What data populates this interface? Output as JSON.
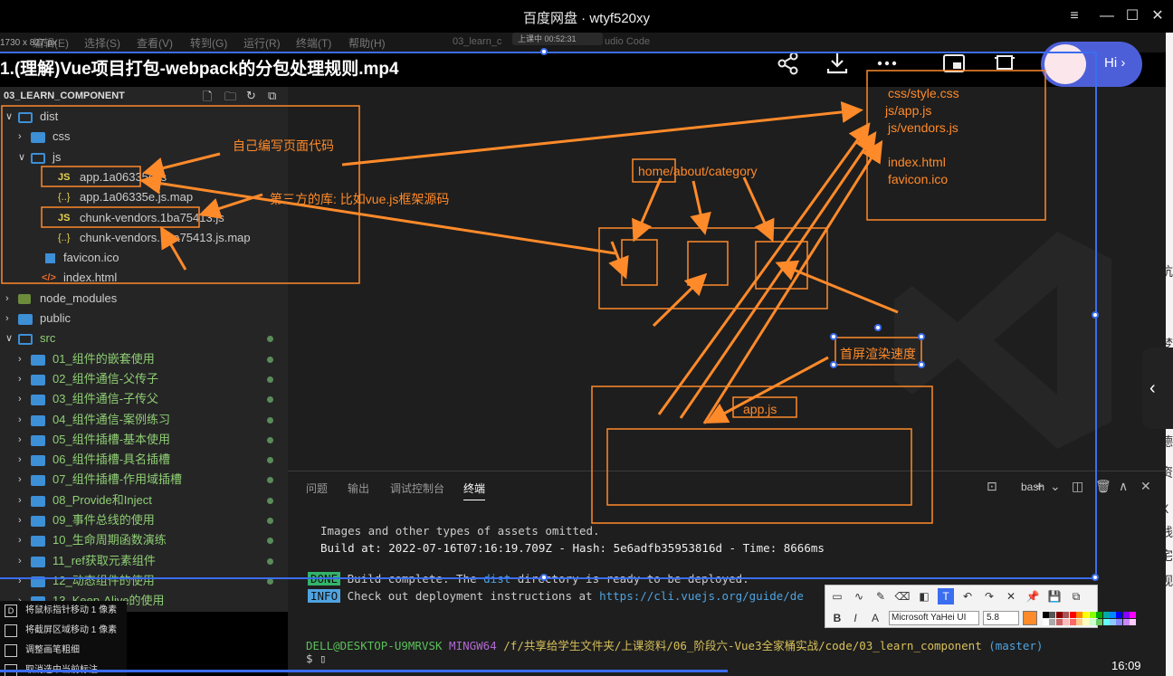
{
  "window": {
    "title": "百度网盘 · wtyf520xy",
    "controls": {
      "settings": "≡",
      "minimize": "—",
      "maximize": "☐",
      "close": "✕"
    }
  },
  "menubar": {
    "items": [
      "编辑(E)",
      "选择(S)",
      "查看(V)",
      "转到(G)",
      "运行(R)",
      "终端(T)",
      "帮助(H)"
    ],
    "file_tab": "03_learn_c",
    "app_suffix": "udio Code",
    "recording": "上课中 00:52:31",
    "dimension": "1730 x 827 px"
  },
  "video": {
    "title": "1.(理解)Vue项目打包-webpack的分包处理规则.mp4",
    "hi": "Hi",
    "hi_arrow": "›",
    "time": "16:09",
    "progress_fraction": 0.62
  },
  "explorer": {
    "header": "03_LEARN_COMPONENT",
    "items": [
      {
        "label": "dist",
        "kind": "folder-open",
        "depth": 0,
        "chev": "∨"
      },
      {
        "label": "css",
        "kind": "folder",
        "depth": 1,
        "chev": "›"
      },
      {
        "label": "js",
        "kind": "folder-open",
        "depth": 1,
        "chev": "∨"
      },
      {
        "label": "app.1a06335e.js",
        "kind": "js",
        "depth": 2,
        "icon_text": "JS"
      },
      {
        "label": "app.1a06335e.js.map",
        "kind": "map",
        "depth": 2,
        "icon_text": "{..}"
      },
      {
        "label": "chunk-vendors.1ba75413.js",
        "kind": "js",
        "depth": 2,
        "icon_text": "JS"
      },
      {
        "label": "chunk-vendors.1ba75413.js.map",
        "kind": "map",
        "depth": 2,
        "icon_text": "{..}"
      },
      {
        "label": "favicon.ico",
        "kind": "img",
        "depth": 1
      },
      {
        "label": "index.html",
        "kind": "html",
        "depth": 1,
        "icon_text": "</>"
      },
      {
        "label": "node_modules",
        "kind": "nm",
        "depth": 0,
        "chev": "›"
      },
      {
        "label": "public",
        "kind": "folder",
        "depth": 0,
        "chev": "›"
      },
      {
        "label": "src",
        "kind": "folder-open",
        "depth": 0,
        "chev": "∨",
        "green": true,
        "dot": true
      },
      {
        "label": "01_组件的嵌套使用",
        "kind": "folder",
        "depth": 1,
        "chev": "›",
        "green": true,
        "dot": true
      },
      {
        "label": "02_组件通信-父传子",
        "kind": "folder",
        "depth": 1,
        "chev": "›",
        "green": true,
        "dot": true
      },
      {
        "label": "03_组件通信-子传父",
        "kind": "folder",
        "depth": 1,
        "chev": "›",
        "green": true,
        "dot": true
      },
      {
        "label": "04_组件通信-案例练习",
        "kind": "folder",
        "depth": 1,
        "chev": "›",
        "green": true,
        "dot": true
      },
      {
        "label": "05_组件插槽-基本使用",
        "kind": "folder",
        "depth": 1,
        "chev": "›",
        "green": true,
        "dot": true
      },
      {
        "label": "06_组件插槽-具名插槽",
        "kind": "folder",
        "depth": 1,
        "chev": "›",
        "green": true,
        "dot": true
      },
      {
        "label": "07_组件插槽-作用域插槽",
        "kind": "folder",
        "depth": 1,
        "chev": "›",
        "green": true,
        "dot": true
      },
      {
        "label": "08_Provide和Inject",
        "kind": "folder",
        "depth": 1,
        "chev": "›",
        "green": true,
        "dot": true
      },
      {
        "label": "09_事件总线的使用",
        "kind": "folder",
        "depth": 1,
        "chev": "›",
        "green": true,
        "dot": true
      },
      {
        "label": "10_生命周期函数演练",
        "kind": "folder",
        "depth": 1,
        "chev": "›",
        "green": true,
        "dot": true
      },
      {
        "label": "11_ref获取元素组件",
        "kind": "folder",
        "depth": 1,
        "chev": "›",
        "green": true,
        "dot": true
      },
      {
        "label": "12_动态组件的使用",
        "kind": "folder",
        "depth": 1,
        "chev": "›",
        "green": true,
        "dot": true
      },
      {
        "label": "13_Keep-Alive的使用",
        "kind": "folder",
        "depth": 1,
        "chev": "›",
        "green": true,
        "dot": false
      }
    ]
  },
  "panel": {
    "tabs": [
      "问题",
      "输出",
      "调试控制台",
      "终端"
    ],
    "active_tab": "终端",
    "shell": "bash",
    "icons": [
      "+",
      "⌄",
      "◫",
      "🗑",
      "∧",
      "✕"
    ],
    "terminal": {
      "line1": "Images and other types of assets omitted.",
      "line2": "Build at: 2022-07-16T07:16:19.709Z - Hash: 5e6adfb35953816d - Time: 8666ms",
      "done_badge": "DONE",
      "line3_a": "Build complete. The ",
      "line3_b": "dist",
      "line3_c": " directory is ready to be deployed.",
      "info_badge": "INFO",
      "line4_a": "Check out deployment instructions at ",
      "line4_b": "https://cli.vuejs.org/guide/de",
      "prompt_user": "DELL@DESKTOP-U9MRVSK",
      "prompt_env": "MINGW64",
      "prompt_path": "/f/共享给学生文件夹/上课资料/06_阶段六-Vue3全家桶实战/code/03_learn_component",
      "prompt_branch": "(master)",
      "cursor": "$"
    }
  },
  "annotations": {
    "self_code": "自己编写页面代码",
    "third_party": "第三方的库: 比如vue.js框架源码",
    "right_files": [
      "css/style.css",
      "js/app.js",
      "js/vendors.js",
      "",
      "index.html",
      "favicon.ico"
    ],
    "routes": "home/about/category",
    "first_screen": "首屏渲染速度",
    "appjs": "app.js",
    "accent": "#ff8a2a"
  },
  "drawbar": {
    "font": "Microsoft YaHei UI",
    "size": "5.8",
    "tools_row1": [
      "▭",
      "∿",
      "✎",
      "⌫",
      "◧",
      "T",
      "↶",
      "↷",
      "✕",
      "📌",
      "💾",
      "⧉"
    ],
    "tools_row2": [
      "B",
      "I",
      "A"
    ],
    "current_color": "#ff8a2a"
  },
  "kb_hints": [
    {
      "key": "D",
      "text": "将鼠标指针移动 1 像素"
    },
    {
      "key": "",
      "text": "将截屏区域移动 1 像素"
    },
    {
      "key": "",
      "text": "调整画笔粗细"
    },
    {
      "key": "",
      "text": "取消选中当前标注"
    }
  ],
  "right_strip_chars": [
    "杭",
    "梦",
    "神",
    "梓",
    "德",
    "资",
    "X",
    "践",
    "宅",
    "视"
  ],
  "collapse": "‹"
}
